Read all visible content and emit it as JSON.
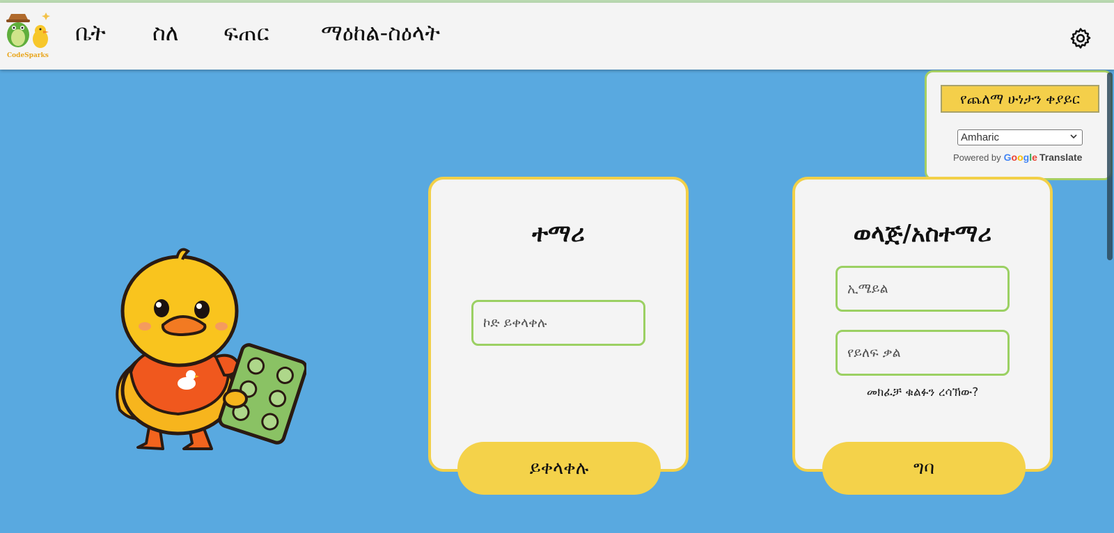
{
  "brand": {
    "logo_text": "CodeSparks"
  },
  "nav": {
    "items": [
      {
        "label": "ቤት"
      },
      {
        "label": "ስለ"
      },
      {
        "label": "ፍጠር"
      },
      {
        "label": "ማዕከል-ስዕላት"
      }
    ]
  },
  "settings": {
    "dark_mode_label": "የጨለማ ሁነታን ቀያይር",
    "language_selected": "Amharic",
    "powered_by": "Powered by",
    "google": "Google",
    "translate": "Translate"
  },
  "student_card": {
    "title": "ተማሪ",
    "code_placeholder": "ኮድ ይቀላቀሉ",
    "join_label": "ይቀላቀሉ"
  },
  "parent_card": {
    "title": "ወላጅ/አስተማሪ",
    "email_placeholder": "ኢሜይል",
    "password_placeholder": "የይለፍ ቃል",
    "forgot_label": "መክፈቻ ቁልፉን ረሳኽው?",
    "login_label": "ግባ"
  },
  "colors": {
    "background": "#59a9e0",
    "card_border": "#f2d048",
    "field_border": "#9bd063",
    "button": "#f4d24a",
    "navbar": "#f4f4f4"
  },
  "icons": [
    "logo-icon",
    "gear-icon",
    "chevron-down-icon",
    "duck-mascot-image"
  ]
}
